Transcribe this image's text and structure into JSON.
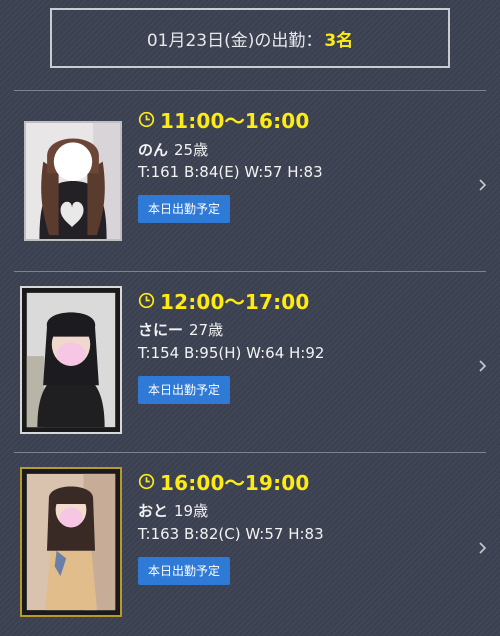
{
  "header": {
    "date_text": "01月23日(金)の出勤：",
    "count": "3名"
  },
  "entries": [
    {
      "time": "11:00〜16:00",
      "name": "のん",
      "age": "25歳",
      "stats": "T:161 B:84(E) W:57 H:83",
      "badge": "本日出勤予定"
    },
    {
      "time": "12:00〜17:00",
      "name": "さにー",
      "age": "27歳",
      "stats": "T:154 B:95(H) W:64 H:92",
      "badge": "本日出勤予定"
    },
    {
      "time": "16:00〜19:00",
      "name": "おと",
      "age": "19歳",
      "stats": "T:163 B:82(C) W:57 H:83",
      "badge": "本日出勤予定"
    }
  ],
  "colors": {
    "accent_yellow": "#ffeb14",
    "badge_blue": "#2f7ad6",
    "background": "#3b4150"
  },
  "icons": {
    "time": "clock-icon",
    "link": "chevron-right-icon"
  }
}
